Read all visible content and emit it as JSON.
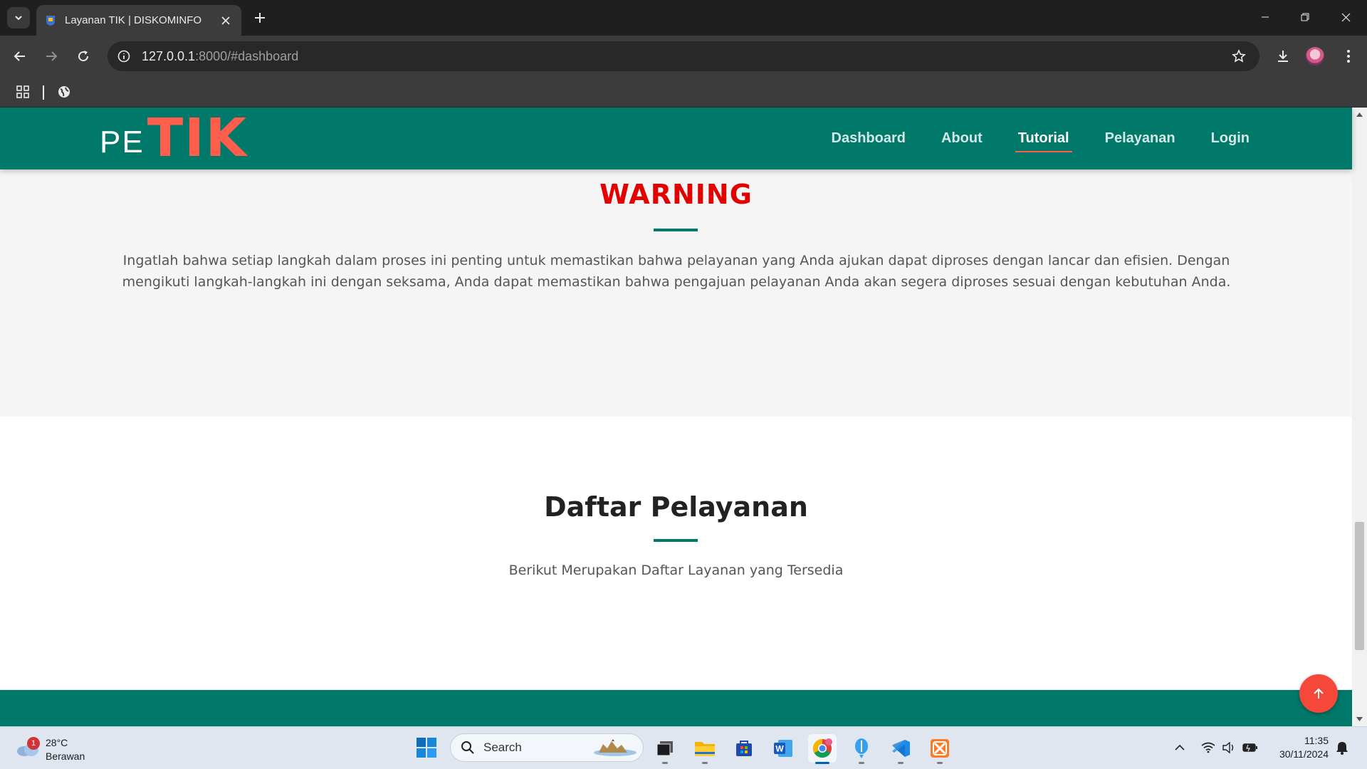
{
  "browser": {
    "tab_title": "Layanan TIK | DISKOMINFO",
    "url_host": "127.0.0.1",
    "url_rest": ":8000/#dashboard"
  },
  "site": {
    "logo_pe": "PE",
    "logo_tik": "TIK",
    "nav": [
      {
        "label": "Dashboard",
        "active": false
      },
      {
        "label": "About",
        "active": false
      },
      {
        "label": "Tutorial",
        "active": true
      },
      {
        "label": "Pelayanan",
        "active": false
      },
      {
        "label": "Login",
        "active": false
      }
    ],
    "warning": {
      "title": "WARNING",
      "text": "Ingatlah bahwa setiap langkah dalam proses ini penting untuk memastikan bahwa pelayanan yang Anda ajukan dapat diproses dengan lancar dan efisien. Dengan mengikuti langkah-langkah ini dengan seksama, Anda dapat memastikan bahwa pengajuan pelayanan Anda akan segera diproses sesuai dengan kebutuhan Anda."
    },
    "services": {
      "title": "Daftar Pelayanan",
      "subtitle": "Berikut Merupakan Daftar Layanan yang Tersedia"
    },
    "colors": {
      "primary": "#00786a",
      "accent": "#ff5e4d",
      "warning": "#e30000"
    }
  },
  "taskbar": {
    "weather_badge": "1",
    "weather_temp": "28°C",
    "weather_desc": "Berawan",
    "search_label": "Search",
    "time": "11:35",
    "date": "30/11/2024"
  }
}
